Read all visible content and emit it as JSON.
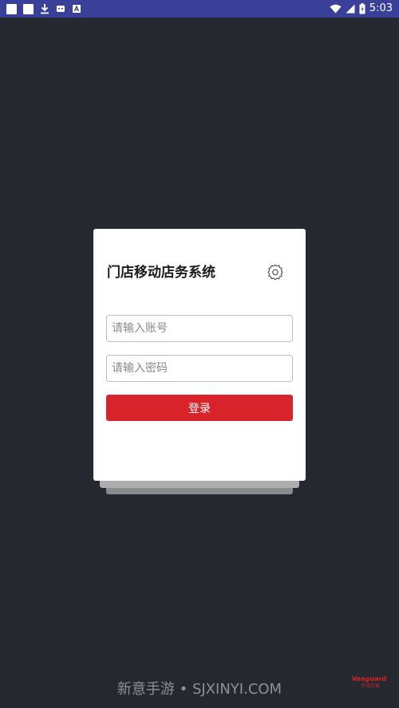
{
  "status_bar": {
    "time": "5:03",
    "left_icons": [
      "notification-square-icon",
      "notification-square-icon",
      "download-icon",
      "sd-card-icon",
      "a-icon"
    ],
    "right_icons": [
      "wifi-icon",
      "cell-signal-icon",
      "battery-charging-icon"
    ]
  },
  "login": {
    "title": "门店移动店务系统",
    "settings_icon": "gear-icon",
    "account_placeholder": "请输入账号",
    "account_value": "",
    "password_placeholder": "请输入密码",
    "password_value": "",
    "login_label": "登录"
  },
  "watermark": {
    "text": "新意手游 • SJXINYI.COM"
  },
  "brand": {
    "name": "Vanguard",
    "sub": "华润万家"
  },
  "colors": {
    "background": "#262830",
    "status_bar": "#3a4099",
    "card": "#ffffff",
    "accent": "#d9232a",
    "field_border": "#bdbdbd"
  }
}
